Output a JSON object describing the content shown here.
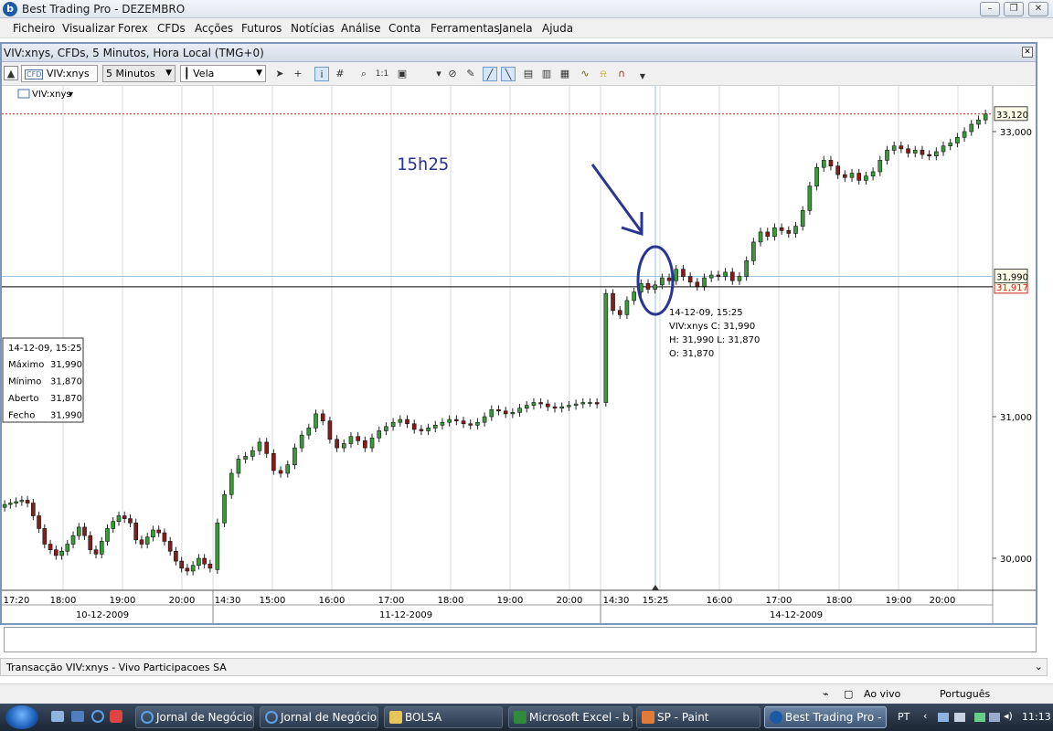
{
  "window": {
    "title": "Best Trading Pro - DEZEMBRO",
    "app_icon": "b"
  },
  "menu": [
    "Ficheiro",
    "Visualizar",
    "Forex",
    "CFDs",
    "Acções",
    "Futuros",
    "Notícias",
    "Análise",
    "Conta",
    "Ferramentas",
    "Janela",
    "Ajuda"
  ],
  "chart_window": {
    "title": "VIV:xnys, CFDs, 5 Minutos, Hora Local (TMG+0)",
    "symbol": "VIV:xnys",
    "interval": "5 Minutos",
    "chart_style": "Vela",
    "series_label": "VIV:xnys",
    "annotation_text": "15h25"
  },
  "info_box": {
    "date": "14-12-09, 15:25",
    "rows": [
      {
        "label": "Máximo",
        "value": "31,990"
      },
      {
        "label": "Mínimo",
        "value": "31,870"
      },
      {
        "label": "Aberto",
        "value": "31,870"
      },
      {
        "label": "Fecho",
        "value": "31,990"
      }
    ]
  },
  "tooltip": {
    "line1": "14-12-09, 15:25",
    "line2": "VIV:xnys   C: 31,990",
    "line3": "H: 31,990    L: 31,870",
    "line4": "O: 31,870"
  },
  "chart_data": {
    "type": "candlestick",
    "y_tick_labels": [
      "33,000",
      "31,000",
      "30,000"
    ],
    "y_ticks": [
      33.0,
      31.0,
      30.0
    ],
    "y_range": [
      29.9,
      33.3
    ],
    "price_labels": {
      "top": "33,120",
      "current": "31,990",
      "crosshair": "31,917"
    },
    "price_levels": {
      "top": 33.12,
      "current": 31.99,
      "crosshair": 31.917
    },
    "x_time_labels": [
      "17:20",
      "18:00",
      "19:00",
      "20:00",
      "14:30",
      "15:00",
      "16:00",
      "17:00",
      "18:00",
      "19:00",
      "20:00",
      "14:30",
      "15:25",
      "16:00",
      "17:00",
      "18:00",
      "19:00",
      "20:00"
    ],
    "x_date_labels": [
      "10-12-2009",
      "11-12-2009",
      "14-12-2009"
    ],
    "closes": [
      30.38,
      30.39,
      30.4,
      30.41,
      30.39,
      30.3,
      30.21,
      30.1,
      30.06,
      30.02,
      30.05,
      30.1,
      30.16,
      30.22,
      30.16,
      30.06,
      30.03,
      30.12,
      30.21,
      30.26,
      30.3,
      30.28,
      30.25,
      30.13,
      30.1,
      30.15,
      30.2,
      30.18,
      30.12,
      30.05,
      29.98,
      29.93,
      29.91,
      29.95,
      30.0,
      29.96,
      29.93,
      30.25,
      30.45,
      30.6,
      30.7,
      30.72,
      30.76,
      30.82,
      30.74,
      30.62,
      30.6,
      30.66,
      30.78,
      30.87,
      30.92,
      31.02,
      30.97,
      30.84,
      30.78,
      30.81,
      30.86,
      30.83,
      30.78,
      30.85,
      30.9,
      30.93,
      30.96,
      30.98,
      30.95,
      30.91,
      30.9,
      30.92,
      30.94,
      30.96,
      30.98,
      30.97,
      30.95,
      30.94,
      30.96,
      31.0,
      31.05,
      31.04,
      31.02,
      31.03,
      31.06,
      31.08,
      31.1,
      31.09,
      31.07,
      31.06,
      31.07,
      31.08,
      31.09,
      31.1,
      31.1,
      31.09,
      31.87,
      31.75,
      31.72,
      31.82,
      31.88,
      31.94,
      31.9,
      31.93,
      31.98,
      31.96,
      32.04,
      31.99,
      31.95,
      31.92,
      31.98,
      32.0,
      31.99,
      32.02,
      31.96,
      31.99,
      32.1,
      32.23,
      32.3,
      32.27,
      32.33,
      32.31,
      32.29,
      32.34,
      32.45,
      32.62,
      32.75,
      32.8,
      32.76,
      32.7,
      32.68,
      32.71,
      32.66,
      32.69,
      32.72,
      32.8,
      32.87,
      32.9,
      32.88,
      32.85,
      32.87,
      32.84,
      32.83,
      32.86,
      32.9,
      32.92,
      32.96,
      33.0,
      33.05,
      33.08,
      33.12
    ]
  },
  "status_panel": {
    "text": "Transacção VIV:xnys - Vivo Participacoes SA"
  },
  "statusbar": {
    "live": "Ao vivo",
    "language": "Português"
  },
  "taskbar": {
    "buttons": [
      {
        "label": "Jornal de Negócios...",
        "icon": "ie-icon"
      },
      {
        "label": "Jornal de Negócios...",
        "icon": "ie-icon"
      },
      {
        "label": "BOLSA",
        "icon": "folder-icon"
      },
      {
        "label": "Microsoft Excel - b...",
        "icon": "excel-icon"
      },
      {
        "label": "SP - Paint",
        "icon": "paint-icon"
      },
      {
        "label": "Best Trading Pro - ...",
        "icon": "app-icon"
      }
    ],
    "tray_lang": "PT",
    "clock": "11:13"
  }
}
